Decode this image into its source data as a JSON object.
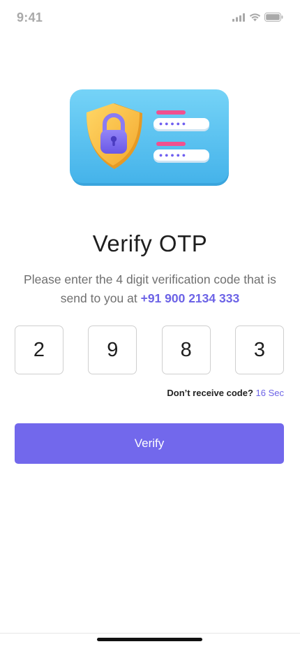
{
  "status_bar": {
    "time": "9:41",
    "icons": [
      "signal-icon",
      "wifi-icon",
      "battery-icon"
    ]
  },
  "illustration": {
    "icon": "shield-lock-card-illustration",
    "field_mask": "•••••"
  },
  "title": "Verify OTP",
  "subtitle": {
    "line1": "Please enter the 4 digit verification code that is",
    "line2_prefix": "send to you at ",
    "phone": "+91 900 2134 333"
  },
  "otp": {
    "digits": [
      "2",
      "9",
      "8",
      "3"
    ]
  },
  "resend": {
    "label": "Don’t receive code? ",
    "timer": "16 Sec"
  },
  "verify_button": {
    "label": "Verify"
  },
  "colors": {
    "accent": "#7268ec",
    "link": "#6c63e6",
    "card": "#5cc3ef",
    "shield": "#f7c34a",
    "lock": "#7d6df0",
    "bar_pink": "#f1508f"
  }
}
